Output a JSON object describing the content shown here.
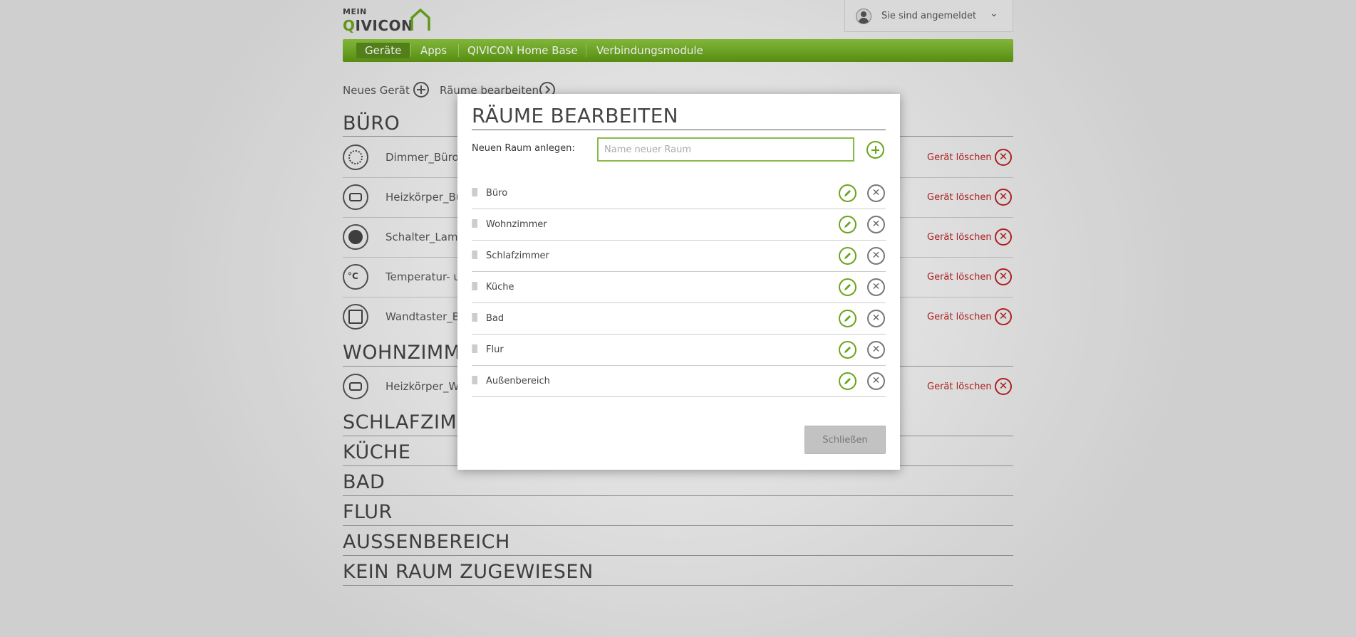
{
  "header": {
    "logo_small": "MEIN",
    "logo_brand_q": "Q",
    "logo_brand_rest": "IVICON",
    "user_label": "Sie sind angemeldet"
  },
  "nav": {
    "items": [
      {
        "label": "Geräte",
        "active": true
      },
      {
        "label": "Apps"
      },
      {
        "label": "QIVICON Home Base"
      },
      {
        "label": "Verbindungsmodule"
      }
    ]
  },
  "toolbar": {
    "new_device": "Neues Gerät",
    "edit_rooms": "Räume bearbeiten"
  },
  "rooms": [
    {
      "title": "BÜRO",
      "devices": [
        "Dimmer_Büro",
        "Heizkörper_Bü",
        "Schalter_Lamp",
        "Temperatur- u",
        "Wandtaster_B"
      ]
    },
    {
      "title": "WOHNZIMM",
      "devices": [
        "Heizkörper_W"
      ]
    },
    {
      "title": "SCHLAFZIM"
    },
    {
      "title": "KÜCHE"
    },
    {
      "title": "BAD"
    },
    {
      "title": "FLUR"
    },
    {
      "title": "AUSSENBEREICH"
    },
    {
      "title": "KEIN RAUM ZUGEWIESEN"
    }
  ],
  "delete_device_label": "Gerät löschen",
  "modal": {
    "title": "RÄUME BEARBEITEN",
    "new_room_label": "Neuen Raum anlegen:",
    "new_room_placeholder": "Name neuer Raum",
    "room_list": [
      "Büro",
      "Wohnzimmer",
      "Schlafzimmer",
      "Küche",
      "Bad",
      "Flur",
      "Außenbereich"
    ],
    "close_label": "Schließen"
  },
  "colors": {
    "accent_green": "#6aa51c",
    "nav_green": "#8cc63f",
    "delete_red": "#bb2222"
  }
}
